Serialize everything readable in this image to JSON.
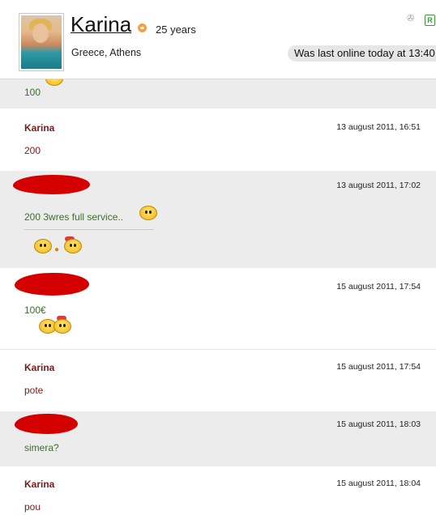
{
  "profile": {
    "name": "Karina",
    "age": "25 years",
    "location": "Greece, Athens",
    "last_online": "Was last online today at 13:40",
    "badge": "R"
  },
  "messages": [
    {
      "body": "100"
    },
    {
      "sender": "Karina",
      "timestamp": "13 august 2011, 16:51",
      "body": "200"
    },
    {
      "timestamp": "13 august 2011, 17:02",
      "body": "200 3wres full service.."
    },
    {
      "timestamp": "15 august 2011, 17:54",
      "body": "100€"
    },
    {
      "sender": "Karina",
      "timestamp": "15 august 2011, 17:54",
      "body": "pote"
    },
    {
      "timestamp": "15 august 2011, 18:03",
      "body": "simera?"
    },
    {
      "sender": "Karina",
      "timestamp": "15 august 2011, 18:04",
      "body": "pou"
    }
  ],
  "colors": {
    "grey_bg": "#ececec",
    "sender": "#7a1a1a",
    "green_text": "#3e6e2a",
    "redaction": "#d40000"
  }
}
